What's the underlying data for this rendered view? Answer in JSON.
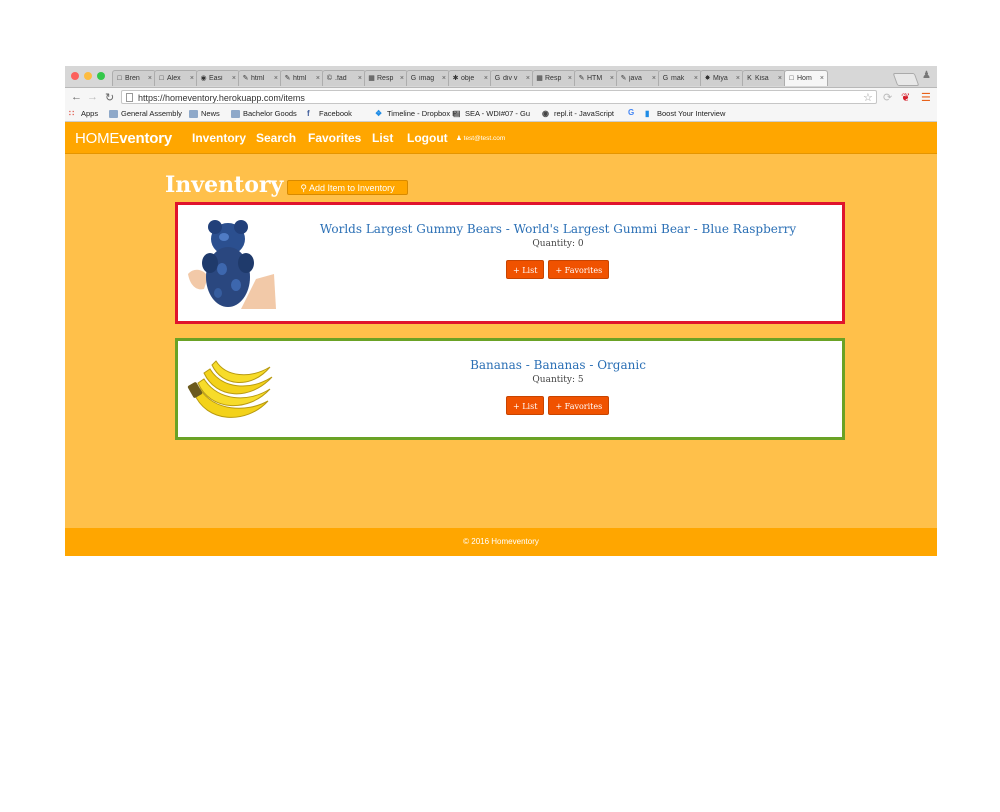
{
  "browser": {
    "tabs": [
      {
        "label": "Bren",
        "icon": "page-icon"
      },
      {
        "label": "Alex",
        "icon": "page-icon"
      },
      {
        "label": "Easi",
        "icon": "shield-icon"
      },
      {
        "label": "html",
        "icon": "pencil-icon"
      },
      {
        "label": "html",
        "icon": "pencil-icon"
      },
      {
        "label": ".fad",
        "icon": "spiral-icon"
      },
      {
        "label": "Resp",
        "icon": "grid-icon"
      },
      {
        "label": "imag",
        "icon": "google-icon"
      },
      {
        "label": "obje",
        "icon": "star-icon"
      },
      {
        "label": "div v",
        "icon": "google-icon"
      },
      {
        "label": "Resp",
        "icon": "grid-icon"
      },
      {
        "label": "HTM",
        "icon": "pencil-icon"
      },
      {
        "label": "java",
        "icon": "pencil-icon"
      },
      {
        "label": "mak",
        "icon": "google-icon"
      },
      {
        "label": "Miya",
        "icon": "yelp-icon"
      },
      {
        "label": "Kisa",
        "icon": "k-icon"
      },
      {
        "label": "Hom",
        "icon": "page-icon",
        "active": true
      }
    ],
    "url": "https://homeventory.herokuapp.com/items",
    "bookmarks": [
      {
        "label": "Apps",
        "icon": "apps-icon"
      },
      {
        "label": "General Assembly",
        "icon": "folder-icon"
      },
      {
        "label": "News",
        "icon": "folder-icon"
      },
      {
        "label": "Bachelor Goods",
        "icon": "folder-icon"
      },
      {
        "label": "Facebook",
        "icon": "facebook-icon"
      },
      {
        "label": "Timeline - Dropbox P",
        "icon": "dropbox-icon"
      },
      {
        "label": "SEA - WDI#07 - Gu",
        "icon": "trello-icon"
      },
      {
        "label": "repl.it - JavaScript",
        "icon": "replit-icon"
      },
      {
        "label": "",
        "icon": "google-icon"
      },
      {
        "label": "Boost Your Interview",
        "icon": "bookmark-icon"
      }
    ]
  },
  "app": {
    "brand_home": "HOME",
    "brand_ventory": "ventory",
    "nav": [
      "Inventory",
      "Search",
      "Favorites",
      "List",
      "Logout"
    ],
    "user_email": "test@test.com",
    "page_title": "Inventory",
    "add_button": "Add Item to Inventory",
    "items": [
      {
        "title": "Worlds Largest Gummy Bears - World's Largest Gummi Bear - Blue Raspberry",
        "quantity": "Quantity: 0",
        "list_button": "+ List",
        "favorites_button": "+ Favorites",
        "border_color": "#e0132d"
      },
      {
        "title": "Bananas - Bananas - Organic",
        "quantity": "Quantity: 5",
        "list_button": "+ List",
        "favorites_button": "+ Favorites",
        "border_color": "#6aa225"
      }
    ],
    "footer": "© 2016 Homeventory"
  },
  "colors": {
    "page_bg": "#ffc04a",
    "nav_bg": "#ffa600",
    "button": "#f05200",
    "link": "#2a6fb5"
  }
}
